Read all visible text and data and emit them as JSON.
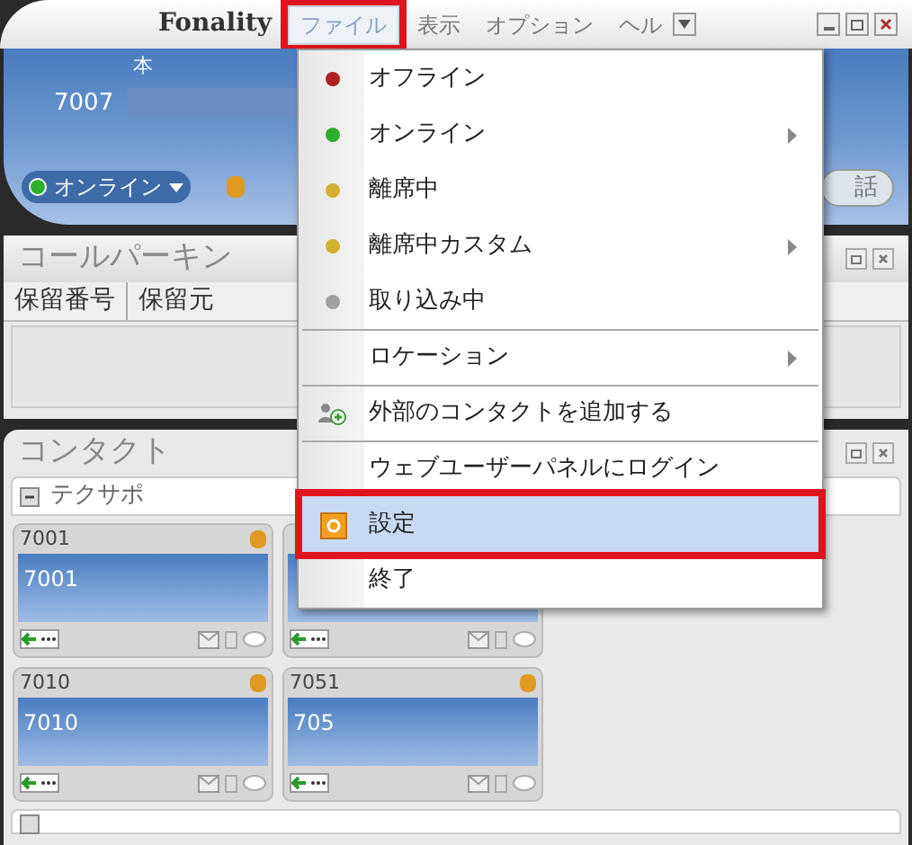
{
  "window": {
    "title": "Fonality"
  },
  "menu_bar": [
    {
      "label": "ファイル",
      "selected": true,
      "annotated": true
    },
    {
      "label": "表示",
      "selected": false,
      "annotated": false
    },
    {
      "label": "オプション",
      "selected": false,
      "annotated": false
    },
    {
      "label": "ヘル",
      "selected": false,
      "annotated": false
    }
  ],
  "header": {
    "tab": "本",
    "extension": "7007",
    "status": "オンライン",
    "call_button": "話"
  },
  "call_parking": {
    "title": "コールパーキン",
    "columns": [
      "保留番号",
      "保留元"
    ]
  },
  "contacts": {
    "title": "コンタクト",
    "groups": [
      {
        "name": "テクサポ",
        "expanded": true,
        "cards": [
          {
            "kind": "contact",
            "number": "7001",
            "name": "7001"
          },
          {
            "kind": "contact"
          },
          {
            "kind": "contact",
            "number": "7010",
            "name": "7010"
          },
          {
            "kind": "contact",
            "number": "7051",
            "name": "705"
          }
        ]
      }
    ]
  },
  "file_menu": {
    "items": [
      {
        "label": "オフライン",
        "kind": "dot",
        "color": "#b02020",
        "submenu": false,
        "separator_before": false,
        "selected": false,
        "annotated": false
      },
      {
        "label": "オンライン",
        "kind": "dot",
        "color": "#2fae2f",
        "submenu": true,
        "separator_before": false,
        "selected": false,
        "annotated": false
      },
      {
        "label": "離席中",
        "kind": "dot",
        "color": "#d4b030",
        "submenu": false,
        "separator_before": false,
        "selected": false,
        "annotated": false
      },
      {
        "label": "離席中カスタム",
        "kind": "dot",
        "color": "#d4b030",
        "submenu": true,
        "separator_before": false,
        "selected": false,
        "annotated": false
      },
      {
        "label": "取り込み中",
        "kind": "dot",
        "color": "#a0a0a0",
        "submenu": false,
        "separator_before": false,
        "selected": false,
        "annotated": false
      },
      {
        "label": "ロケーション",
        "kind": "plain",
        "submenu": true,
        "separator_before": true,
        "selected": false,
        "annotated": false
      },
      {
        "label": "外部のコンタクトを追加する",
        "kind": "people",
        "submenu": false,
        "separator_before": true,
        "selected": false,
        "annotated": false
      },
      {
        "label": "ウェブユーザーパネルにログイン",
        "kind": "plain",
        "submenu": false,
        "separator_before": true,
        "selected": false,
        "annotated": false
      },
      {
        "label": "設定",
        "kind": "settings",
        "submenu": false,
        "separator_before": false,
        "selected": true,
        "annotated": true
      },
      {
        "label": "終了",
        "kind": "plain",
        "submenu": false,
        "separator_before": false,
        "selected": false,
        "annotated": false
      }
    ]
  }
}
